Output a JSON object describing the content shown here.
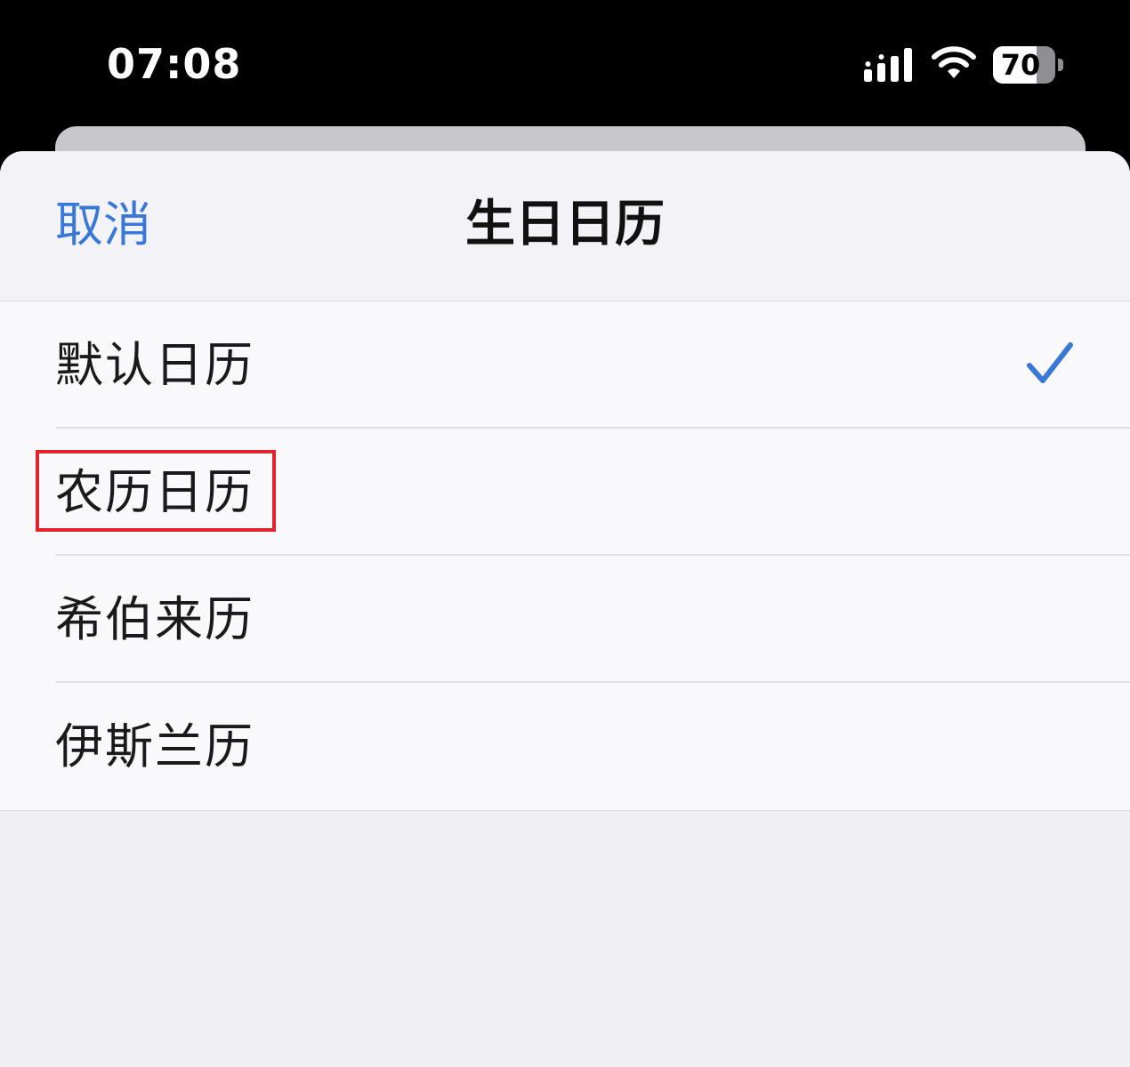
{
  "status_bar": {
    "time": "07:08",
    "signal_icon": "cellular-signal-icon",
    "wifi_icon": "wifi-icon",
    "battery_level": "70",
    "battery_fraction": 0.7
  },
  "nav": {
    "cancel_label": "取消",
    "title": "生日日历"
  },
  "calendar_options": [
    {
      "label": "默认日历",
      "selected": true
    },
    {
      "label": "农历日历",
      "selected": false,
      "highlighted": true
    },
    {
      "label": "希伯来历",
      "selected": false
    },
    {
      "label": "伊斯兰历",
      "selected": false
    }
  ],
  "colors": {
    "accent": "#3a78d8",
    "highlight_border": "#e0242b",
    "sheet_background": "#efeff4",
    "list_background": "#f9f9fb"
  },
  "icons": {
    "selected_marker": "checkmark-icon"
  }
}
